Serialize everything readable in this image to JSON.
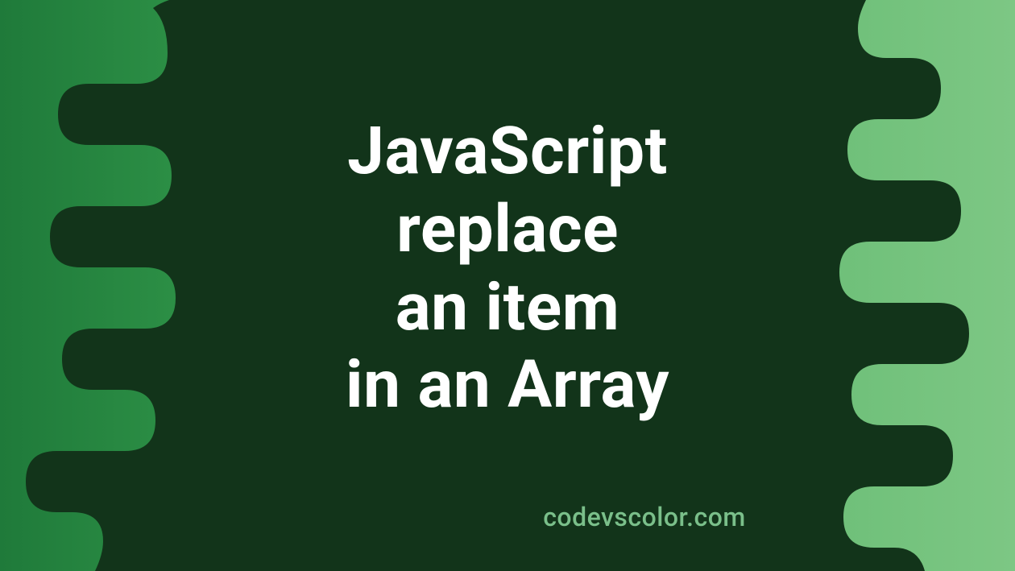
{
  "title": {
    "line1": "JavaScript",
    "line2": "replace",
    "line3": "an item",
    "line4": "in an Array"
  },
  "watermark": "codevscolor.com",
  "colors": {
    "blob": "#12341a",
    "gradient_start": "#1f7a3a",
    "gradient_end": "#7dc784",
    "text": "#ffffff",
    "watermark": "#7abf8a"
  }
}
